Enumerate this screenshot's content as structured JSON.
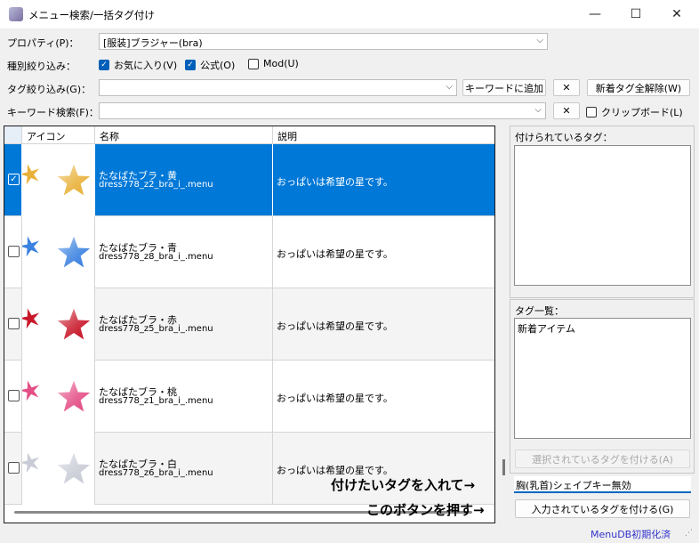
{
  "window": {
    "title": "メニュー検索/一括タグ付け",
    "min_glyph": "—",
    "max_glyph": "☐",
    "close_glyph": "✕"
  },
  "property": {
    "label": "プロパティ(P)：",
    "value": "[服装]ブラジャー(bra)"
  },
  "type_filter": {
    "label": "種別絞り込み：",
    "options": [
      {
        "label": "お気に入り(V)",
        "checked": true
      },
      {
        "label": "公式(O)",
        "checked": true
      },
      {
        "label": "Mod(U)",
        "checked": false
      }
    ]
  },
  "tag_filter": {
    "label": "タグ絞り込み(G)：",
    "value": "",
    "add_keyword_button": "キーワードに追加",
    "clear_button": "✕",
    "reset_new_tags_button": "新着タグ全解除(W)"
  },
  "keyword_search": {
    "label": "キーワード検索(F)：",
    "value": "",
    "clear_button": "✕",
    "clipboard_label": "クリップボード(L)",
    "clipboard_checked": false
  },
  "grid": {
    "columns": [
      "アイコン",
      "名称",
      "説明"
    ],
    "rows": [
      {
        "name": "たなばたブラ・黄",
        "file": "dress778_z2_bra_i_.menu",
        "description": "おっぱいは希望の星です。",
        "color": "#e9b13a",
        "selected": true,
        "checked": true
      },
      {
        "name": "たなばたブラ・青",
        "file": "dress778_z8_bra_i_.menu",
        "description": "おっぱいは希望の星です。",
        "color": "#3b82e0",
        "selected": false,
        "checked": false
      },
      {
        "name": "たなばたブラ・赤",
        "file": "dress778_z5_bra_i_.menu",
        "description": "おっぱいは希望の星です。",
        "color": "#c8182a",
        "selected": false,
        "checked": false
      },
      {
        "name": "たなばたブラ・桃",
        "file": "dress778_z1_bra_i_.menu",
        "description": "おっぱいは希望の星です。",
        "color": "#e44f86",
        "selected": false,
        "checked": false
      },
      {
        "name": "たなばたブラ・白",
        "file": "dress778_z6_bra_i_.menu",
        "description": "おっぱいは希望の星です。",
        "color": "#c9ccd6",
        "selected": false,
        "checked": false
      }
    ]
  },
  "right_panel": {
    "applied_tags_label": "付けられているタグ：",
    "tag_list_label": "タグ一覧：",
    "tag_list_items": [
      "新着アイテム"
    ],
    "apply_selected_button": "選択されているタグを付ける(A)",
    "tag_input_value": "胸(乳首)シェイプキー無効",
    "apply_input_button": "入力されているタグを付ける(G)"
  },
  "annotations": {
    "input_hint": "付けたいタグを入れて→",
    "button_hint": "このボタンを押す→"
  },
  "status": {
    "reset_link": "MenuDB初期化済"
  }
}
